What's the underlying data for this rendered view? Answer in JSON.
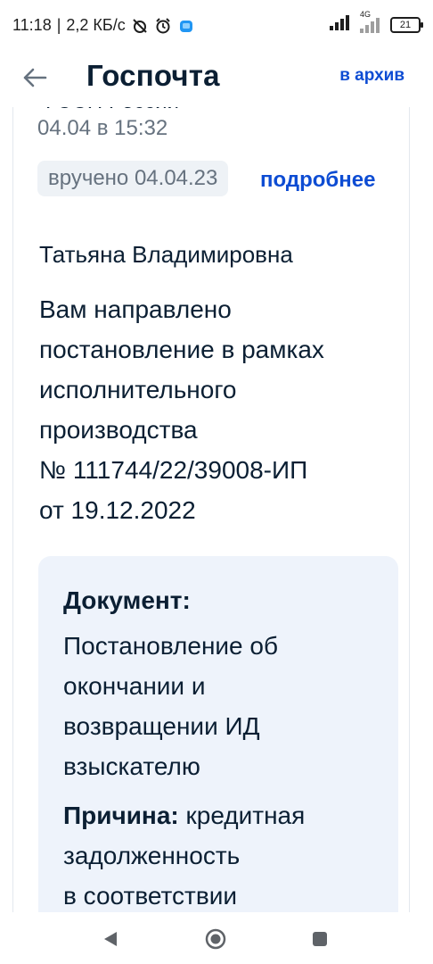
{
  "status_bar": {
    "time": "11:18",
    "net_speed": "2,2 КБ/с",
    "network_type": "4G",
    "battery": "21",
    "icons": [
      "alarm-off-icon",
      "alarm-icon",
      "app-notification-icon",
      "signal-icon",
      "wifi-icon",
      "battery-icon"
    ]
  },
  "header": {
    "title": "Госпочта",
    "archive_label": "в архив",
    "back_icon": "arrow-left-icon"
  },
  "message": {
    "sender_clipped": "ФССП России",
    "date": "04.04 в 15:32",
    "status_badge": "вручено 04.04.23",
    "details_link": "подробнее",
    "recipient": "Татьяна Владимировна",
    "body_lines": [
      "Вам направлено",
      "постановление в рамках",
      "исполнительного",
      "производства",
      "№ 111744/22/39008-ИП",
      "от 19.12.2022"
    ],
    "document": {
      "label": "Документ:",
      "value_lines": [
        "Постановление об",
        "окончании и",
        "возвращении ИД",
        "взыскателю"
      ]
    },
    "reason": {
      "label": "Причина:",
      "text_first": " кредитная",
      "text_lines": [
        "задолженность",
        "в соответствии"
      ]
    }
  },
  "colors": {
    "accent": "#0d4cd3",
    "text": "#0b1f33",
    "muted": "#66727f",
    "badge_bg": "#eef2f6",
    "doc_bg": "#eef3fb"
  },
  "nav": {
    "back": "nav-back-icon",
    "home": "nav-home-icon",
    "recents": "nav-recents-icon"
  }
}
